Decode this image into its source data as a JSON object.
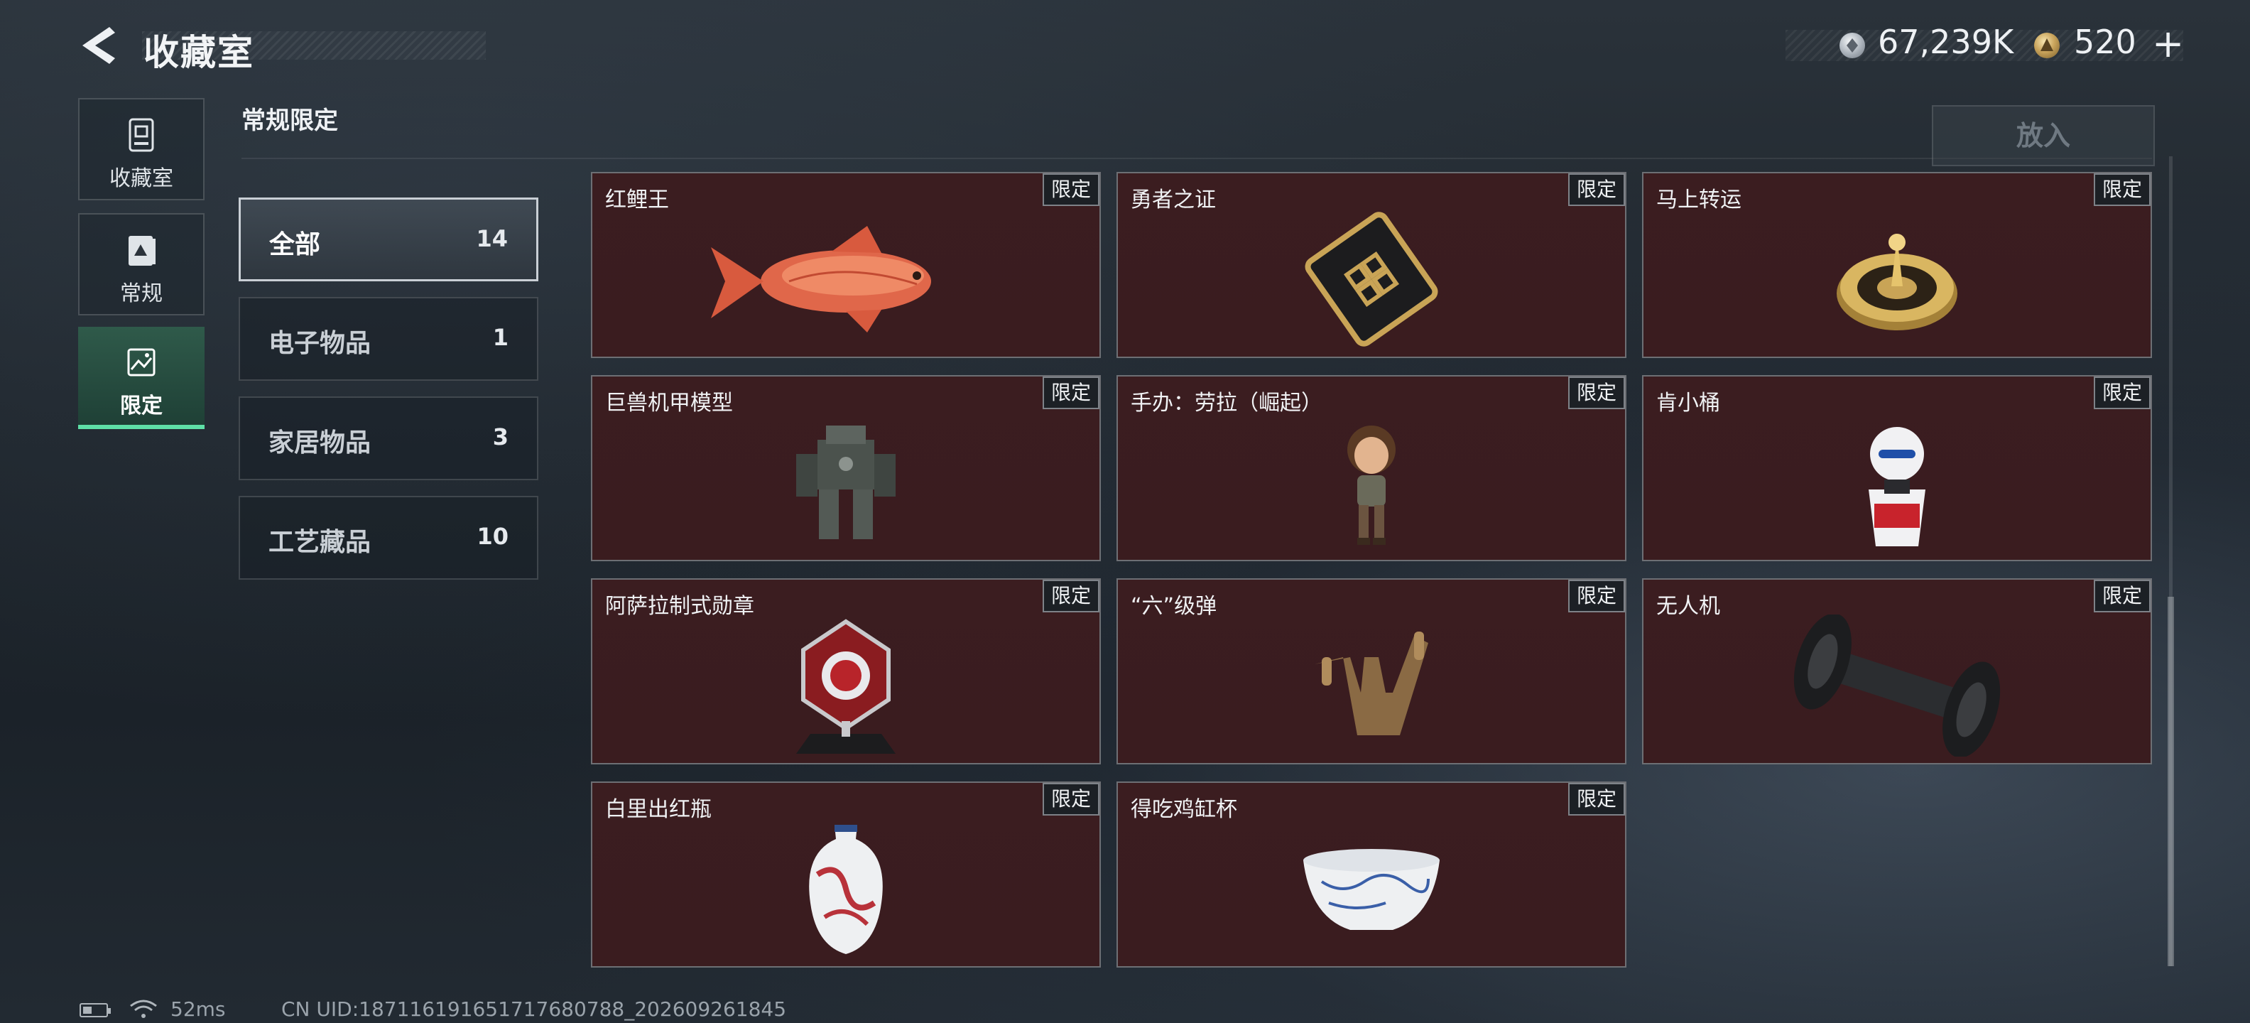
{
  "header": {
    "title": "收藏室",
    "currency_silver": "67,239K",
    "currency_gold": "520",
    "plus_label": "+"
  },
  "nav": {
    "items": [
      {
        "label": "收藏室",
        "icon": "collection-room-icon",
        "active": false
      },
      {
        "label": "常规",
        "icon": "regular-icon",
        "active": false
      },
      {
        "label": "限定",
        "icon": "limited-icon",
        "active": true
      }
    ]
  },
  "section": {
    "title": "常规限定",
    "put_in_label": "放入"
  },
  "categories": [
    {
      "name": "全部",
      "count": "14",
      "active": true
    },
    {
      "name": "电子物品",
      "count": "1",
      "active": false
    },
    {
      "name": "家居物品",
      "count": "3",
      "active": false
    },
    {
      "name": "工艺藏品",
      "count": "10",
      "active": false
    }
  ],
  "items": [
    {
      "name": "红鲤王",
      "tag": "限定",
      "icon": "red-carp-icon"
    },
    {
      "name": "勇者之证",
      "tag": "限定",
      "icon": "hero-card-icon"
    },
    {
      "name": "马上转运",
      "tag": "限定",
      "icon": "golden-compass-icon"
    },
    {
      "name": "巨兽机甲模型",
      "tag": "限定",
      "icon": "mech-model-icon"
    },
    {
      "name": "手办：劳拉（崛起）",
      "tag": "限定",
      "icon": "lara-figure-icon"
    },
    {
      "name": "肯小桶",
      "tag": "限定",
      "icon": "kfc-figure-icon"
    },
    {
      "name": "阿萨拉制式勋章",
      "tag": "限定",
      "icon": "medal-icon"
    },
    {
      "name": "“六”级弹",
      "tag": "限定",
      "icon": "bullet-hand-icon"
    },
    {
      "name": "无人机",
      "tag": "限定",
      "icon": "drone-icon"
    },
    {
      "name": "白里出红瓶",
      "tag": "限定",
      "icon": "porcelain-vase-icon"
    },
    {
      "name": "得吃鸡缸杯",
      "tag": "限定",
      "icon": "porcelain-cup-icon"
    }
  ],
  "footer": {
    "ping": "52ms",
    "uid": "CN UID:187116191651717680788_202609261845"
  }
}
